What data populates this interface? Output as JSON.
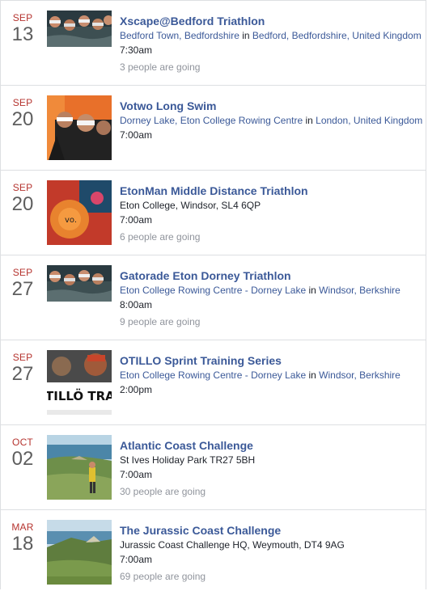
{
  "events": [
    {
      "month": "SEP",
      "day": "13",
      "title": "Xscape@Bedford Triathlon",
      "venue": "Bedford Town, Bedfordshire",
      "joiner": "in",
      "city": "Bedford, Bedfordshire, United Kingdom",
      "time": "7:30am",
      "going": "3 people are going",
      "thumb_icon": "swimmers-photo"
    },
    {
      "month": "SEP",
      "day": "20",
      "title": "Votwo Long Swim",
      "venue": "Dorney Lake, Eton College Rowing Centre",
      "joiner": "in",
      "city": "London, United Kingdom",
      "time": "7:00am",
      "going": "",
      "thumb_icon": "swimmers-photo"
    },
    {
      "month": "SEP",
      "day": "20",
      "title": "EtonMan Middle Distance Triathlon",
      "address": "Eton College, Windsor, SL4 6QP",
      "time": "7:00am",
      "going": "6 people are going",
      "thumb_icon": "swim-cap-photo"
    },
    {
      "month": "SEP",
      "day": "27",
      "title": "Gatorade Eton Dorney Triathlon",
      "venue": "Eton College Rowing Centre - Dorney Lake",
      "joiner": "in",
      "city": "Windsor, Berkshire",
      "time": "8:00am",
      "going": "9 people are going",
      "thumb_icon": "swimmers-photo"
    },
    {
      "month": "SEP",
      "day": "27",
      "title": "OTILLO Sprint Training Series",
      "venue": "Eton College Rowing Centre - Dorney Lake",
      "joiner": "in",
      "city": "Windsor, Berkshire",
      "time": "2:00pm",
      "going": "",
      "thumb_icon": "otillo-training-photo",
      "thumb_text": "TILLÖ TRAINI"
    },
    {
      "month": "OCT",
      "day": "02",
      "title": "Atlantic Coast Challenge",
      "address": "St Ives Holiday Park TR27 5BH",
      "time": "7:00am",
      "going": "30 people are going",
      "thumb_icon": "coast-walker-photo"
    },
    {
      "month": "MAR",
      "day": "18",
      "title": "The Jurassic Coast Challenge",
      "address": "Jurassic Coast Challenge HQ, Weymouth, DT4 9AG",
      "time": "7:00am",
      "going": "69 people are going",
      "thumb_icon": "coast-cliff-photo"
    }
  ],
  "colors": {
    "link": "#3b5998",
    "month": "#b5332e",
    "day": "#5e5e5e",
    "muted": "#90949c",
    "divider": "#dddfe2"
  }
}
